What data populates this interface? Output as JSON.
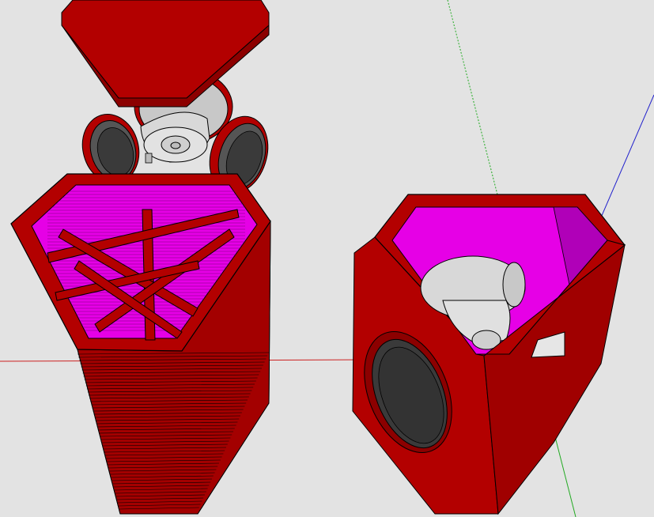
{
  "scene": {
    "background": "#e3e3e3",
    "colors": {
      "body_red": "#b30000",
      "body_red_dark": "#8c0000",
      "body_red_light": "#cc1010",
      "interior_magenta": "#e600e6",
      "interior_magenta_dark": "#b000b8",
      "speaker_grey": "#d8d8d8",
      "speaker_grey_dark": "#9a9a9a",
      "cone_black": "#3a3a3a",
      "edge": "#000000"
    },
    "axes": {
      "red_axis_color": "#cc2020",
      "green_axis_color": "#22aa22",
      "blue_axis_color": "#2020cc"
    },
    "objects": [
      {
        "name": "lid",
        "description_icon": "hexagonal-lid-icon"
      },
      {
        "name": "speaker-driver-top",
        "description_icon": "speaker-driver-icon"
      },
      {
        "name": "speaker-ring-left",
        "description_icon": "speaker-ring-icon"
      },
      {
        "name": "speaker-ring-right",
        "description_icon": "speaker-ring-icon"
      },
      {
        "name": "enclosure-left",
        "description_icon": "enclosure-icon"
      },
      {
        "name": "enclosure-right",
        "description_icon": "enclosure-icon"
      }
    ]
  }
}
